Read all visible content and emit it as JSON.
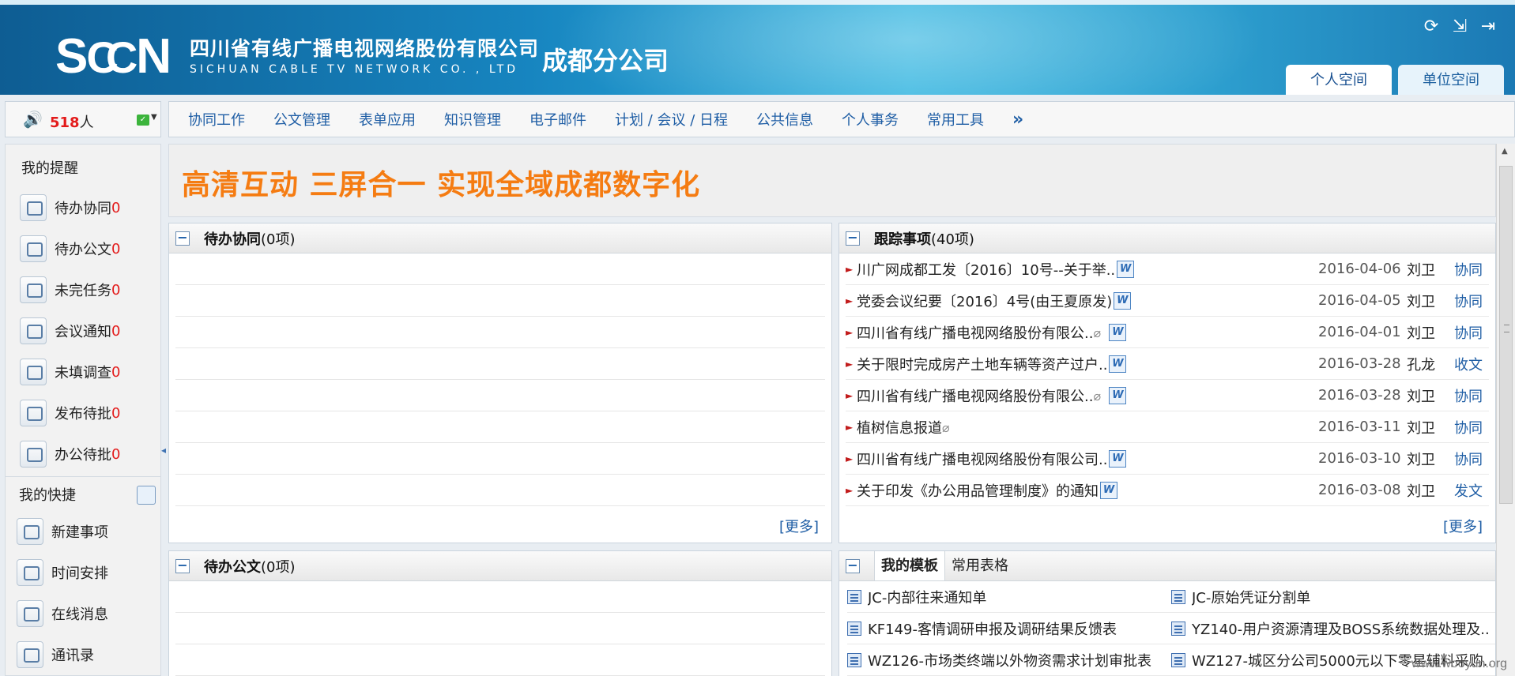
{
  "header": {
    "logo_text": "SCCN",
    "company_cn": "四川省有线广播电视网络股份有限公司",
    "company_en": "SICHUAN CABLE TV NETWORK CO. , LTD",
    "branch": "成都分公司",
    "icons": [
      "refresh-icon",
      "export-icon",
      "logout-icon"
    ],
    "space_tabs": [
      {
        "label": "个人空间",
        "active": true
      },
      {
        "label": "单位空间",
        "active": false
      }
    ]
  },
  "online": {
    "count": "518",
    "unit": "人"
  },
  "nav": {
    "items": [
      "协同工作",
      "公文管理",
      "表单应用",
      "知识管理",
      "电子邮件",
      "计划 / 会议 / 日程",
      "公共信息",
      "个人事务",
      "常用工具"
    ],
    "more": "»"
  },
  "sidebar": {
    "reminders_title": "我的提醒",
    "reminders": [
      {
        "label": "待办协同",
        "count": "0"
      },
      {
        "label": "待办公文",
        "count": "0"
      },
      {
        "label": "未完任务",
        "count": "0"
      },
      {
        "label": "会议通知",
        "count": "0"
      },
      {
        "label": "未填调查",
        "count": "0"
      },
      {
        "label": "发布待批",
        "count": "0"
      },
      {
        "label": "办公待批",
        "count": "0"
      }
    ],
    "shortcuts_title": "我的快捷",
    "shortcuts": [
      "新建事项",
      "时间安排",
      "在线消息",
      "通讯录"
    ]
  },
  "banner": {
    "text": "高清互动 三屏合一 实现全域成都数字化"
  },
  "pending_collab": {
    "title": "待办协同",
    "count": "(0项)",
    "more": "[更多]"
  },
  "pending_docs": {
    "title": "待办公文",
    "count": "(0项)"
  },
  "tracking": {
    "title": "跟踪事项",
    "count": "(40项)",
    "more": "[更多]",
    "rows": [
      {
        "title": "川广网成都工发〔2016〕10号--关于举..",
        "date": "2016-04-06",
        "person": "刘卫",
        "type": "协同",
        "clip": false,
        "doc": true
      },
      {
        "title": "党委会议纪要〔2016〕4号(由王夏原发)",
        "date": "2016-04-05",
        "person": "刘卫",
        "type": "协同",
        "clip": false,
        "doc": true
      },
      {
        "title": "四川省有线广播电视网络股份有限公..",
        "date": "2016-04-01",
        "person": "刘卫",
        "type": "协同",
        "clip": true,
        "doc": true
      },
      {
        "title": "关于限时完成房产土地车辆等资产过户..",
        "date": "2016-03-28",
        "person": "孔龙",
        "type": "收文",
        "clip": false,
        "doc": true
      },
      {
        "title": "四川省有线广播电视网络股份有限公..",
        "date": "2016-03-28",
        "person": "刘卫",
        "type": "协同",
        "clip": true,
        "doc": true
      },
      {
        "title": "植树信息报道",
        "date": "2016-03-11",
        "person": "刘卫",
        "type": "协同",
        "clip": true,
        "doc": false
      },
      {
        "title": "四川省有线广播电视网络股份有限公司..",
        "date": "2016-03-10",
        "person": "刘卫",
        "type": "协同",
        "clip": false,
        "doc": true
      },
      {
        "title": "关于印发《办公用品管理制度》的通知",
        "date": "2016-03-08",
        "person": "刘卫",
        "type": "发文",
        "clip": false,
        "doc": true
      }
    ]
  },
  "templates": {
    "tabs": [
      {
        "label": "我的模板",
        "active": true
      },
      {
        "label": "常用表格",
        "active": false
      }
    ],
    "items": [
      "JC-内部往来通知单",
      "JC-原始凭证分割单",
      "KF149-客情调研申报及调研结果反馈表",
      "YZ140-用户资源清理及BOSS系统数据处理及..",
      "WZ126-市场类终端以外物资需求计划审批表",
      "WZ127-城区分公司5000元以下零星辅料采购.."
    ]
  },
  "watermark": "www.wooyun.org",
  "colors": {
    "accent_orange": "#f57c12",
    "link_blue": "#1f5ea5",
    "count_red": "#e31b1b"
  }
}
